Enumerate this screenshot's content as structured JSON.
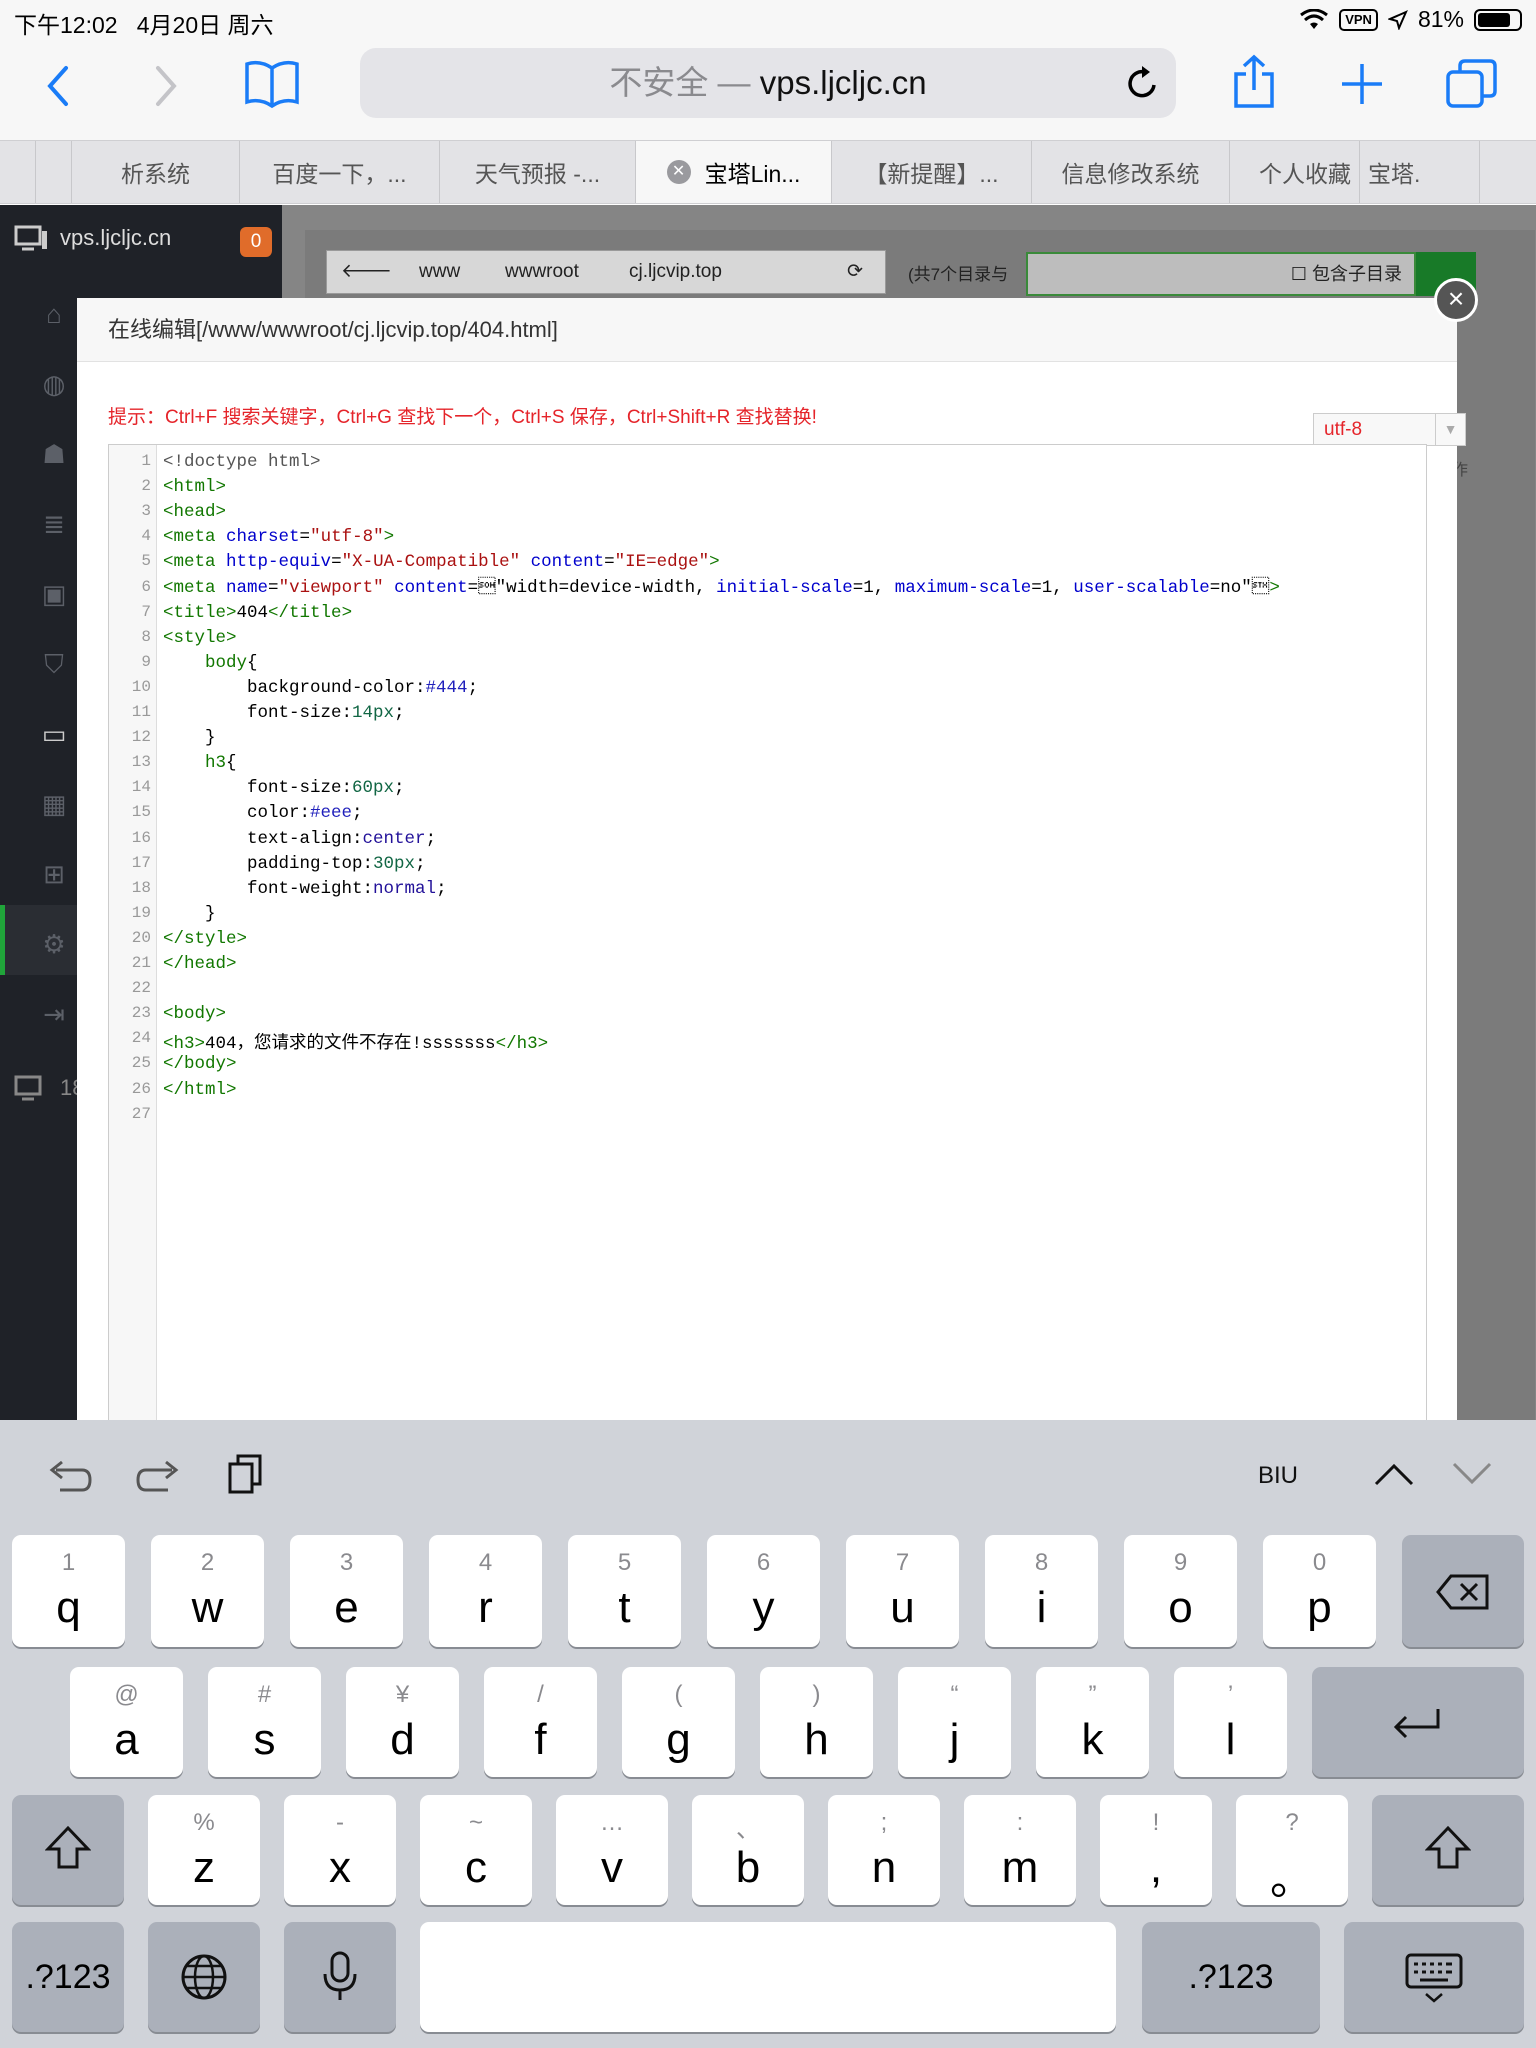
{
  "status": {
    "time": "下午12:02",
    "date": "4月20日 周六",
    "vpn": "VPN",
    "battery": "81%"
  },
  "browser": {
    "url_insecure": "不安全 —",
    "url_host": "vps.ljcljc.cn",
    "tabs": [
      {
        "label": "析系统"
      },
      {
        "label": "百度一下，..."
      },
      {
        "label": "天气预报 -..."
      },
      {
        "label": "宝塔Lin...",
        "active": true
      },
      {
        "label": "【新提醒】..."
      },
      {
        "label": "信息修改系统"
      },
      {
        "label": "个人收藏"
      },
      {
        "label": "宝塔."
      }
    ]
  },
  "panel": {
    "host": "vps.ljcljc.cn",
    "notif_count": "0",
    "host2": "18",
    "path": [
      "www",
      "wwwroot",
      "cj.ljcvip.top"
    ],
    "dir_info": "(共7个目录与",
    "include_subdir": "包含子目录",
    "ops_label": "作"
  },
  "modal": {
    "title": "在线编辑[/www/wwwroot/cj.ljcvip.top/404.html]",
    "tip": "提示：Ctrl+F 搜索关键字，Ctrl+G 查找下一个，Ctrl+S 保存，Ctrl+Shift+R 查找替换!",
    "encoding": "utf-8",
    "close": "×"
  },
  "editor": {
    "line_numbers": [
      "1",
      "2",
      "3",
      "4",
      "5",
      "6",
      "7",
      "8",
      "9",
      "10",
      "11",
      "12",
      "13",
      "14",
      "15",
      "16",
      "17",
      "18",
      "19",
      "20",
      "21",
      "22",
      "23",
      "24",
      "25",
      "26",
      "27"
    ],
    "lines": [
      "<!doctype html>",
      "<html>",
      "<head>",
      "<meta charset=\"utf-8\">",
      "<meta http-equiv=\"X-UA-Compatible\" content=\"IE=edge\">",
      "<meta name=\"viewport\" content=\"width=device-width, initial-scale=1, maximum-scale=1, user-scalable=no\">",
      "<title>404</title>",
      "<style>",
      "    body{",
      "        background-color:#444;",
      "        font-size:14px;",
      "    }",
      "    h3{",
      "        font-size:60px;",
      "        color:#eee;",
      "        text-align:center;",
      "        padding-top:30px;",
      "        font-weight:normal;",
      "    }",
      "</style>",
      "</head>",
      "",
      "<body>",
      "<h3>404，您请求的文件不存在!sssssss</h3>",
      "</body>",
      "</html>",
      ""
    ]
  },
  "keyboard": {
    "format": "BIU",
    "row1": [
      {
        "main": "q",
        "sub": "1"
      },
      {
        "main": "w",
        "sub": "2"
      },
      {
        "main": "e",
        "sub": "3"
      },
      {
        "main": "r",
        "sub": "4"
      },
      {
        "main": "t",
        "sub": "5"
      },
      {
        "main": "y",
        "sub": "6"
      },
      {
        "main": "u",
        "sub": "7"
      },
      {
        "main": "i",
        "sub": "8"
      },
      {
        "main": "o",
        "sub": "9"
      },
      {
        "main": "p",
        "sub": "0"
      }
    ],
    "row2": [
      {
        "main": "a",
        "sub": "@"
      },
      {
        "main": "s",
        "sub": "#"
      },
      {
        "main": "d",
        "sub": "¥"
      },
      {
        "main": "f",
        "sub": "/"
      },
      {
        "main": "g",
        "sub": "("
      },
      {
        "main": "h",
        "sub": ")"
      },
      {
        "main": "j",
        "sub": "“"
      },
      {
        "main": "k",
        "sub": "”"
      },
      {
        "main": "l",
        "sub": "’"
      }
    ],
    "row3": [
      {
        "main": "z",
        "sub": "%"
      },
      {
        "main": "x",
        "sub": "-"
      },
      {
        "main": "c",
        "sub": "~"
      },
      {
        "main": "v",
        "sub": "…"
      },
      {
        "main": "b",
        "sub": "、"
      },
      {
        "main": "n",
        "sub": ";"
      },
      {
        "main": "m",
        "sub": ":"
      },
      {
        "main": ",",
        "sub": "!"
      },
      {
        "main": "。",
        "sub": "?"
      }
    ],
    "num_label": ".?123"
  }
}
